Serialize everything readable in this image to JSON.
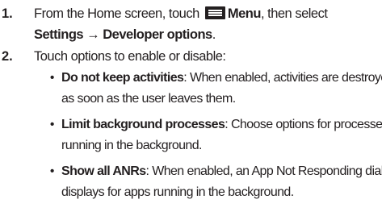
{
  "step1": {
    "number": "1.",
    "line1_prefix": "From the Home screen, touch",
    "menu_label": "Menu",
    "line1_suffix": ", then select",
    "settings_path": "Settings → Developer options",
    "period": "."
  },
  "step2": {
    "number": "2.",
    "text": "Touch options to enable or disable:"
  },
  "bullets": [
    {
      "dot": "•",
      "term": "Do not keep activities",
      "line1": ": When enabled, activities are destroyed",
      "line2": "as soon as the user leaves them."
    },
    {
      "dot": "•",
      "term": "Limit background processes",
      "line1": ": Choose options for processes",
      "line2": "running in the background."
    },
    {
      "dot": "•",
      "term": "Show all ANRs",
      "line1": ": When enabled, an App Not Responding dialog",
      "line2": "displays for apps running in the background."
    }
  ],
  "icons": {
    "menu": "menu-icon"
  }
}
